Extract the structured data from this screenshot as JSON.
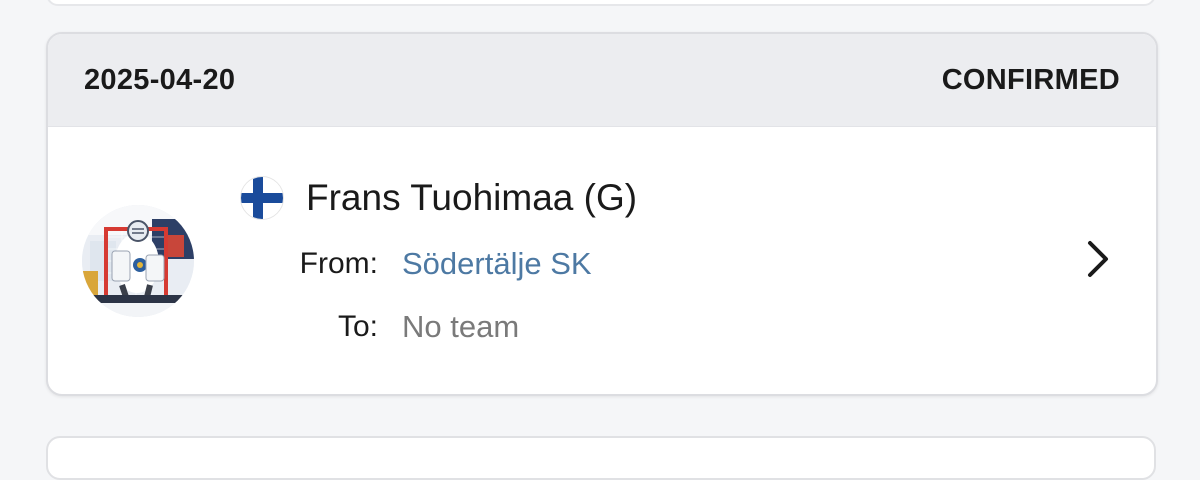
{
  "transfer": {
    "date": "2025-04-20",
    "status": "CONFIRMED",
    "player": {
      "name": "Frans Tuohimaa (G)",
      "flag_icon": "finland-flag-icon",
      "avatar": "player-photo"
    },
    "from_label": "From:",
    "from_team": "Södertälje SK",
    "to_label": "To:",
    "to_team": "No team"
  },
  "colors": {
    "header_bg": "#ecedf0",
    "link_blue": "#4d79a3",
    "muted_gray": "#7a7a7a",
    "flag_blue": "#1a4b9b"
  }
}
